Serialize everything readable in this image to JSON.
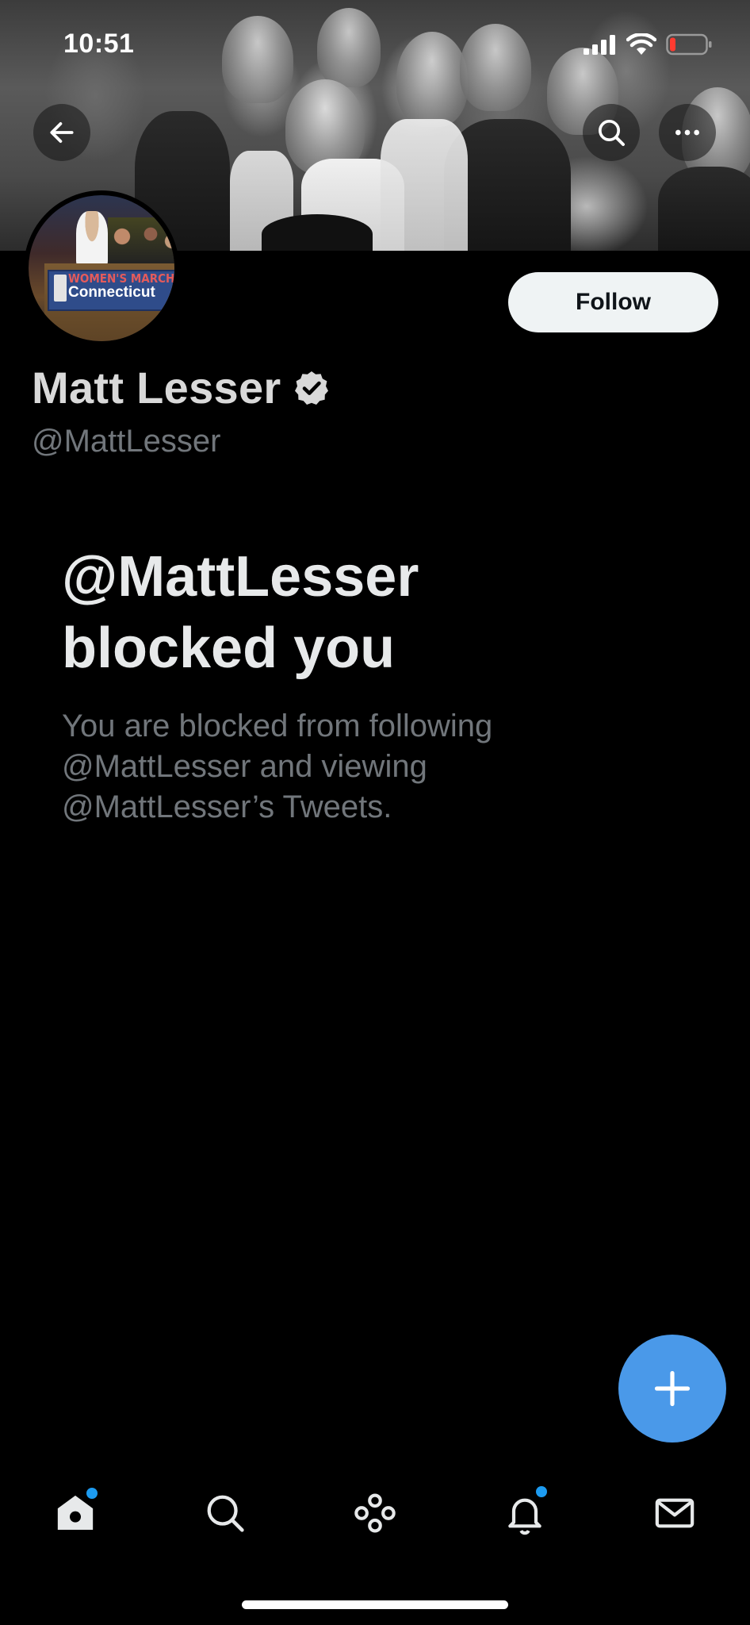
{
  "status_bar": {
    "time": "10:51",
    "icons": [
      "cellular-signal-icon",
      "wifi-icon",
      "battery-low-icon"
    ]
  },
  "header": {
    "back_icon": "arrow-left-icon",
    "search_icon": "search-icon",
    "more_icon": "more-horizontal-icon"
  },
  "profile": {
    "display_name": "Matt Lesser",
    "verified": true,
    "handle": "@MattLesser",
    "follow_label": "Follow",
    "avatar_sign": {
      "top": "WOMEN'S MARCH",
      "main": "Connecticut"
    }
  },
  "blocked": {
    "title_line1": "@MattLesser",
    "title_line2": "blocked you",
    "desc_line1": "You are blocked from following",
    "desc_line2": "@MattLesser and viewing",
    "desc_line3": "@MattLesser’s Tweets."
  },
  "fab": {
    "icon": "plus-icon"
  },
  "tabbar": {
    "items": [
      {
        "name": "home",
        "icon": "home-icon",
        "badge": true
      },
      {
        "name": "explore",
        "icon": "search-icon",
        "badge": false
      },
      {
        "name": "spaces",
        "icon": "spaces-icon",
        "badge": false
      },
      {
        "name": "notifications",
        "icon": "bell-icon",
        "badge": true
      },
      {
        "name": "messages",
        "icon": "mail-icon",
        "badge": false
      }
    ]
  },
  "colors": {
    "background": "#000000",
    "accent": "#1d9bf0",
    "fab": "#4a99e9",
    "secondary_text": "#71767b",
    "follow_button_bg": "#eff3f4"
  }
}
